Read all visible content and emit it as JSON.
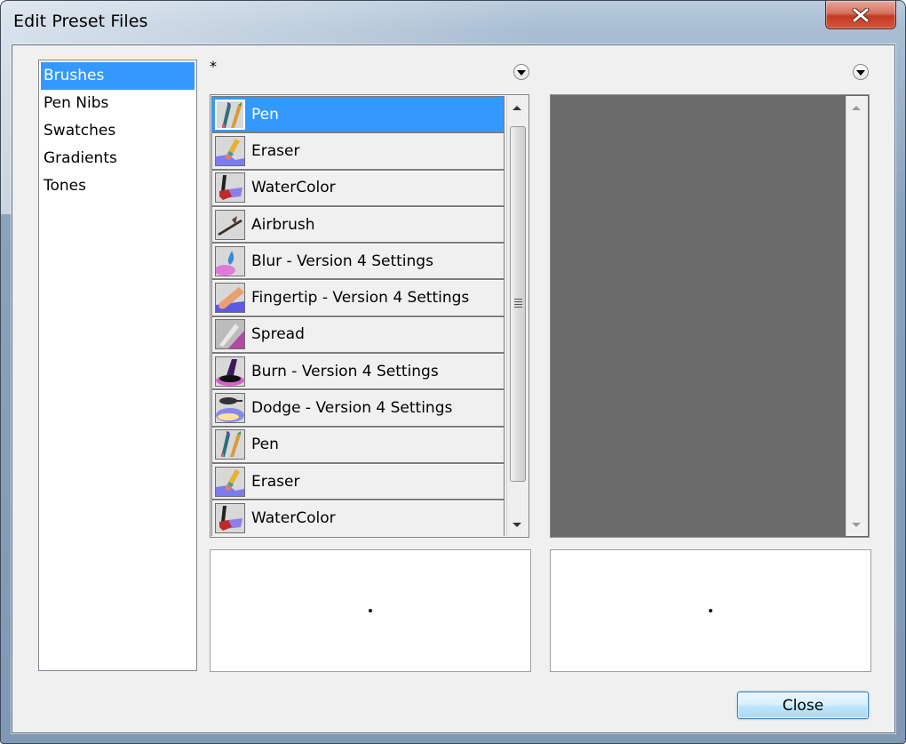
{
  "window": {
    "title": "Edit Preset Files",
    "close_icon": "close-x-icon"
  },
  "categories": {
    "selected": "Brushes",
    "items": [
      {
        "label": "Brushes",
        "selected": true
      },
      {
        "label": "Pen Nibs",
        "selected": false
      },
      {
        "label": "Swatches",
        "selected": false
      },
      {
        "label": "Gradients",
        "selected": false
      },
      {
        "label": "Tones",
        "selected": false
      }
    ]
  },
  "left_panel": {
    "modified_marker": "*",
    "menu_icon": "dropdown-circle-icon",
    "items": [
      {
        "label": "Pen",
        "icon": "pen-icon",
        "selected": true
      },
      {
        "label": "Eraser",
        "icon": "eraser-icon",
        "selected": false
      },
      {
        "label": "WaterColor",
        "icon": "watercolor-icon",
        "selected": false
      },
      {
        "label": "Airbrush",
        "icon": "airbrush-icon",
        "selected": false
      },
      {
        "label": "Blur - Version 4 Settings",
        "icon": "blur-icon",
        "selected": false
      },
      {
        "label": "Fingertip - Version 4 Settings",
        "icon": "fingertip-icon",
        "selected": false
      },
      {
        "label": "Spread",
        "icon": "spread-icon",
        "selected": false
      },
      {
        "label": "Burn - Version 4 Settings",
        "icon": "burn-icon",
        "selected": false
      },
      {
        "label": "Dodge - Version 4 Settings",
        "icon": "dodge-icon",
        "selected": false
      },
      {
        "label": "Pen",
        "icon": "pen-icon",
        "selected": false
      },
      {
        "label": "Eraser",
        "icon": "eraser-icon",
        "selected": false
      },
      {
        "label": "WaterColor",
        "icon": "watercolor-icon",
        "selected": false
      }
    ]
  },
  "right_panel": {
    "menu_icon": "dropdown-circle-icon",
    "items": []
  },
  "footer": {
    "close_label": "Close"
  },
  "colors": {
    "selection": "#3399ff",
    "empty_panel": "#6b6b6b",
    "dialog_bg": "#f0f0f0"
  }
}
